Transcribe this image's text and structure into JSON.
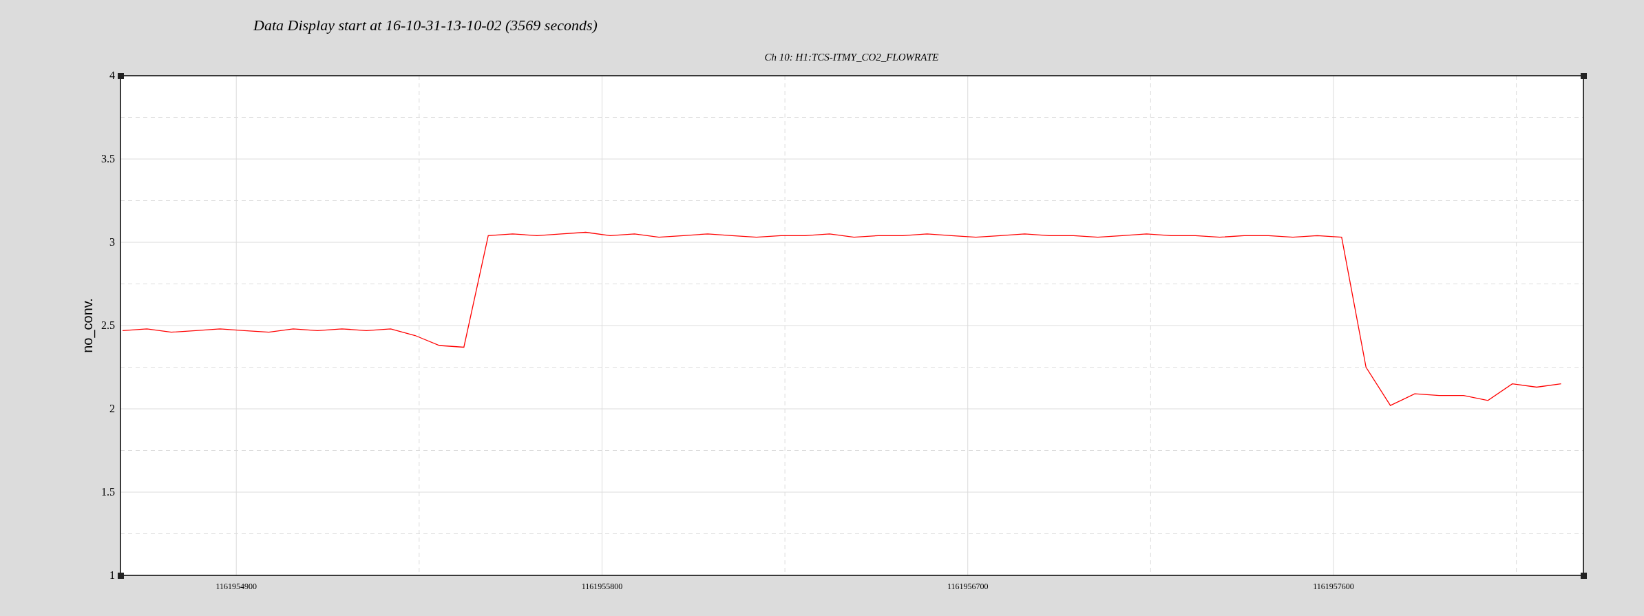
{
  "header": "Data Display start at 16-10-31-13-10-02 (3569 seconds)",
  "plot": {
    "chart_data": {
      "type": "line",
      "title": "Ch 10: H1:TCS-ITMY_CO2_FLOWRATE",
      "ylabel": "no_conv.",
      "xlim": [
        1161954615,
        1161958215
      ],
      "ylim": [
        1,
        4
      ],
      "xticks": [
        1161954900,
        1161955800,
        1161956700,
        1161957600
      ],
      "yticks": [
        1,
        1.5,
        2,
        2.5,
        3,
        3.5,
        4
      ],
      "x": [
        1161954620,
        1161954680,
        1161954740,
        1161954800,
        1161954860,
        1161954920,
        1161954980,
        1161955040,
        1161955100,
        1161955160,
        1161955220,
        1161955280,
        1161955340,
        1161955400,
        1161955460,
        1161955520,
        1161955580,
        1161955640,
        1161955700,
        1161955760,
        1161955820,
        1161955880,
        1161955940,
        1161956000,
        1161956060,
        1161956120,
        1161956180,
        1161956240,
        1161956300,
        1161956360,
        1161956420,
        1161956480,
        1161956540,
        1161956600,
        1161956660,
        1161956720,
        1161956780,
        1161956840,
        1161956900,
        1161956960,
        1161957020,
        1161957080,
        1161957140,
        1161957200,
        1161957260,
        1161957320,
        1161957380,
        1161957440,
        1161957500,
        1161957560,
        1161957620,
        1161957680,
        1161957740,
        1161957800,
        1161957860,
        1161957920,
        1161957980,
        1161958040,
        1161958100,
        1161958160
      ],
      "grid": true,
      "series": [
        {
          "color": "#ff0000",
          "values": [
            2.47,
            2.48,
            2.46,
            2.47,
            2.48,
            2.47,
            2.46,
            2.48,
            2.47,
            2.48,
            2.47,
            2.48,
            2.44,
            2.38,
            2.37,
            3.04,
            3.05,
            3.04,
            3.05,
            3.06,
            3.04,
            3.05,
            3.03,
            3.04,
            3.05,
            3.04,
            3.03,
            3.04,
            3.04,
            3.05,
            3.03,
            3.04,
            3.04,
            3.05,
            3.04,
            3.03,
            3.04,
            3.05,
            3.04,
            3.04,
            3.03,
            3.04,
            3.05,
            3.04,
            3.04,
            3.03,
            3.04,
            3.04,
            3.03,
            3.04,
            3.03,
            2.25,
            2.02,
            2.09,
            2.08,
            2.08,
            2.05,
            2.15,
            2.13,
            2.15
          ]
        }
      ]
    }
  }
}
